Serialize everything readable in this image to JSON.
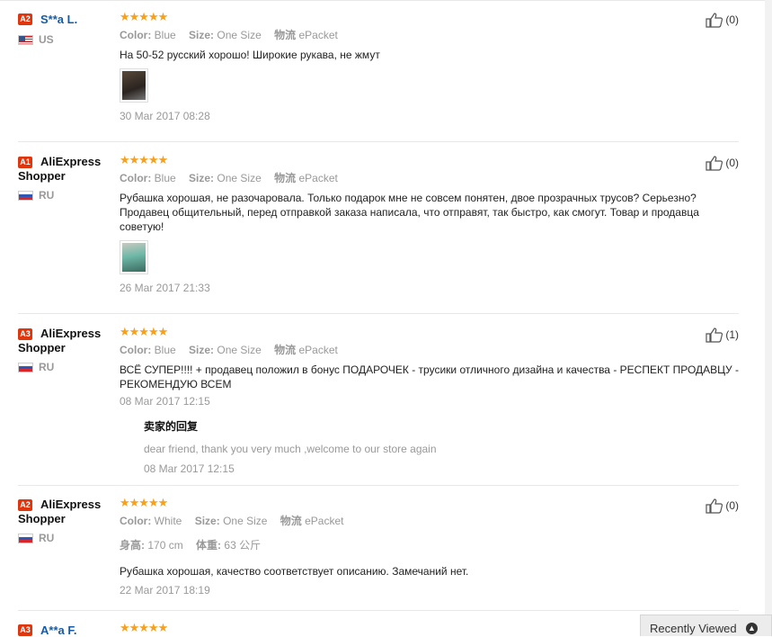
{
  "labels": {
    "color": "Color:",
    "size": "Size:",
    "shipping": "物流",
    "height": "身高:",
    "weight": "体重:"
  },
  "stars": "★★★★★",
  "reviews": [
    {
      "level": "A2",
      "name": "S**a L.",
      "shopper": "",
      "country": "US",
      "flag": "us",
      "color": "Blue",
      "size": "One Size",
      "shipping": "ePacket",
      "text": "На 50-52 русский хорошо! Широкие рукава, не жмут",
      "date": "30 Mar 2017 08:28",
      "likes": "(0)"
    },
    {
      "level": "A1",
      "name": "AliExpress",
      "shopper": "Shopper",
      "country": "RU",
      "flag": "ru",
      "color": "Blue",
      "size": "One Size",
      "shipping": "ePacket",
      "text": "Рубашка хорошая, не разочаровала. Только подарок мне не совсем понятен, двое прозрачных трусов? Серьезно? Продавец общительный, перед отправкой заказа написала, что отправят, так быстро, как смогут. Товар и продавца советую!",
      "date": "26 Mar 2017 21:33",
      "likes": "(0)"
    },
    {
      "level": "A3",
      "name": "AliExpress",
      "shopper": "Shopper",
      "country": "RU",
      "flag": "ru",
      "color": "Blue",
      "size": "One Size",
      "shipping": "ePacket",
      "text": "ВСЁ СУПЕР!!!! + продавец положил в бонус ПОДАРОЧЕК - трусики отличного дизайна и качества - РЕСПЕКТ ПРОДАВЦУ - РЕКОМЕНДУЮ ВСЕМ",
      "date": "08 Mar 2017 12:15",
      "likes": "(1)",
      "reply": {
        "title": "卖家的回复",
        "text": "dear friend, thank you very much ,welcome to our store again",
        "date": "08 Mar 2017 12:15"
      }
    },
    {
      "level": "A2",
      "name": "AliExpress",
      "shopper": "Shopper",
      "country": "RU",
      "flag": "ru",
      "color": "White",
      "size": "One Size",
      "shipping": "ePacket",
      "height": "170 cm",
      "weight": "63 公斤",
      "text": "Рубашка хорошая, качество соответствует описанию. Замечаний нет.",
      "date": "22 Mar 2017 18:19",
      "likes": "(0)"
    },
    {
      "level": "A3",
      "name": "A**a F."
    }
  ],
  "recently_viewed": "Recently Viewed",
  "colors": {
    "level_badge": "#e0360e",
    "star": "#f7a01c",
    "name_link": "#175ba1",
    "muted": "#999999"
  }
}
